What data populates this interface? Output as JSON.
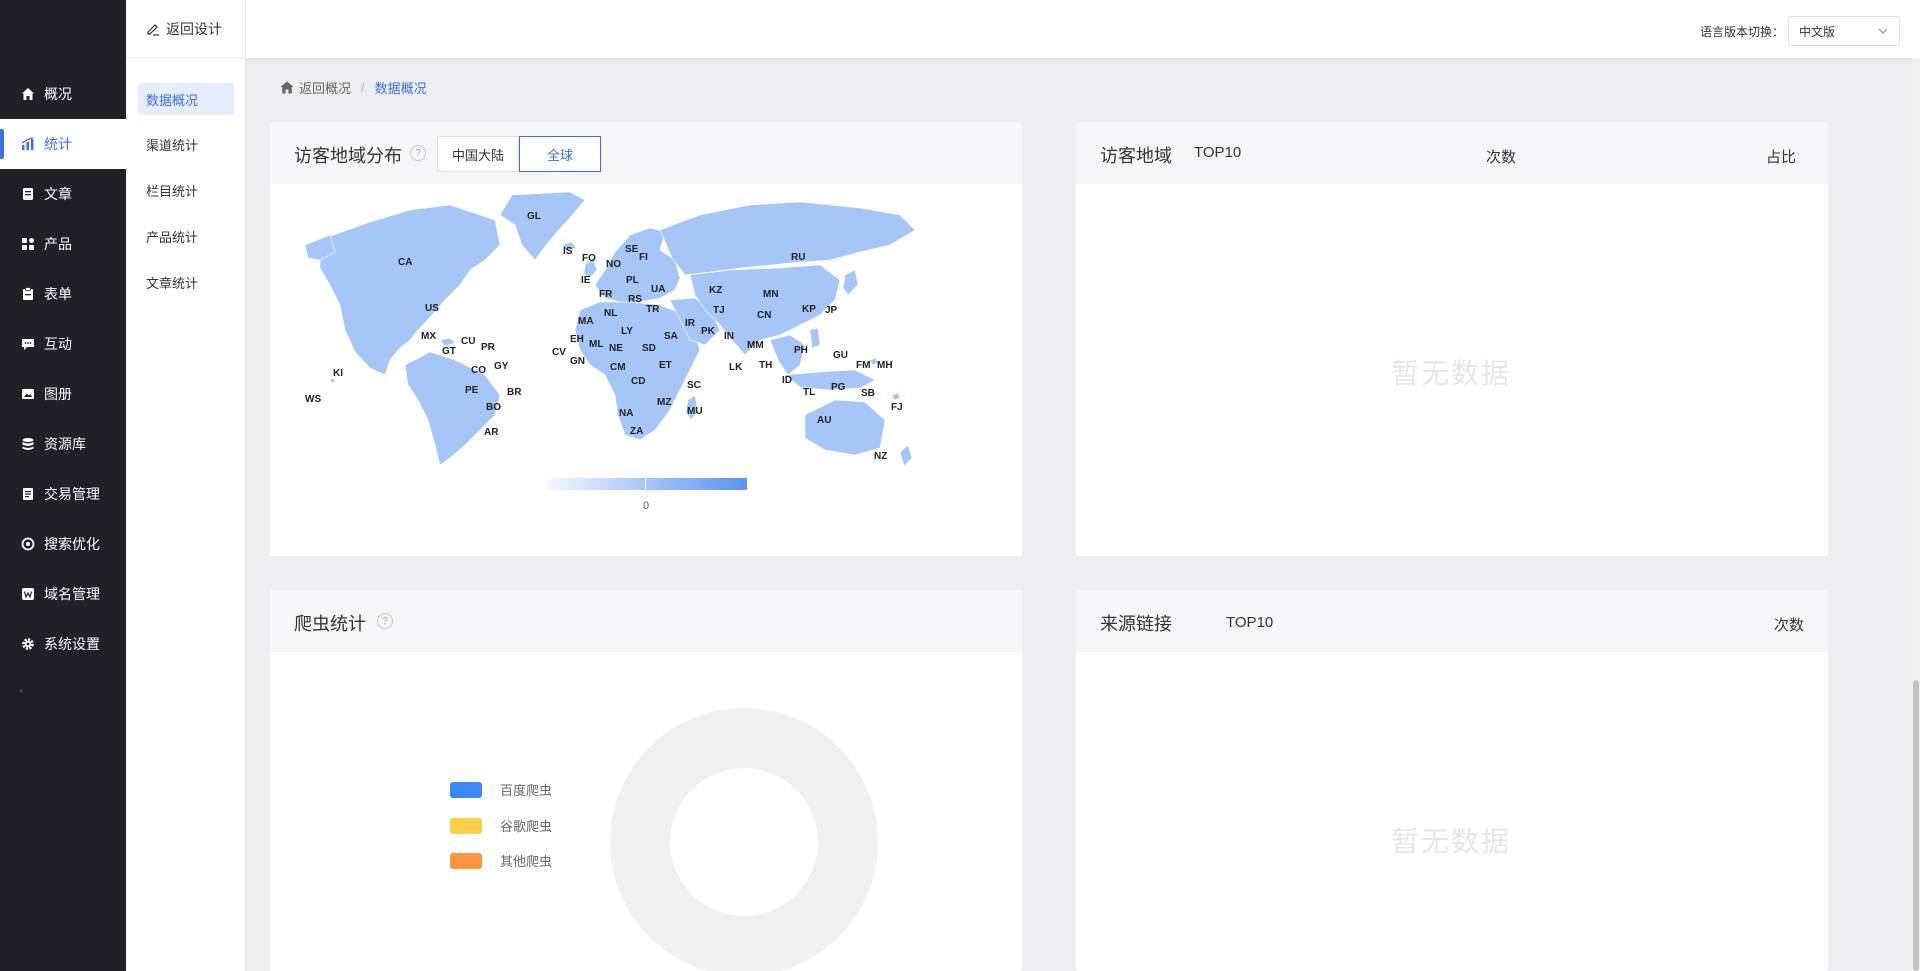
{
  "nav": {
    "items": [
      {
        "label": "概况",
        "icon": "home-icon"
      },
      {
        "label": "统计",
        "icon": "chart-icon"
      },
      {
        "label": "文章",
        "icon": "document-icon"
      },
      {
        "label": "产品",
        "icon": "grid-icon"
      },
      {
        "label": "表单",
        "icon": "clipboard-icon"
      },
      {
        "label": "互动",
        "icon": "chat-icon"
      },
      {
        "label": "图册",
        "icon": "image-icon"
      },
      {
        "label": "资源库",
        "icon": "database-icon"
      },
      {
        "label": "交易管理",
        "icon": "order-icon"
      },
      {
        "label": "搜索优化",
        "icon": "seo-icon"
      },
      {
        "label": "域名管理",
        "icon": "domain-icon"
      },
      {
        "label": "系统设置",
        "icon": "gear-icon"
      }
    ],
    "active_index": 1
  },
  "submenu": {
    "back_label": "返回设计",
    "items": [
      "数据概况",
      "渠道统计",
      "栏目统计",
      "产品统计",
      "文章统计"
    ],
    "active_index": 0
  },
  "topbar": {
    "lang_label": "语言版本切换：",
    "lang_value": "中文版"
  },
  "breadcrumb": {
    "home": "返回概况",
    "separator": "/",
    "current": "数据概况"
  },
  "visitor_map": {
    "title": "访客地域分布",
    "help": "?",
    "tabs": [
      "中国大陆",
      "全球"
    ],
    "selected_tab": 1,
    "legend_min": "0",
    "map_color": "#a6c6f8",
    "labels": [
      "GL",
      "CA",
      "IS",
      "FO",
      "NO",
      "SE",
      "FI",
      "RU",
      "IE",
      "PL",
      "UA",
      "FR",
      "RS",
      "KZ",
      "MN",
      "NL",
      "TR",
      "TJ",
      "CN",
      "KP",
      "JP",
      "US",
      "MA",
      "LY",
      "IR",
      "PK",
      "SA",
      "IN",
      "MX",
      "CU",
      "PR",
      "EH",
      "ML",
      "NE",
      "SD",
      "MM",
      "PH",
      "GU",
      "FM",
      "MH",
      "GT",
      "GY",
      "CV",
      "GN",
      "CM",
      "ET",
      "LK",
      "TH",
      "CO",
      "KI",
      "CD",
      "SC",
      "ID",
      "PG",
      "SB",
      "WS",
      "PE",
      "BR",
      "TL",
      "FJ",
      "MZ",
      "MU",
      "BO",
      "NA",
      "AU",
      "ZA",
      "AR",
      "NZ"
    ]
  },
  "visitor_region": {
    "title": "访客地域",
    "top": "TOP10",
    "col_count": "次数",
    "col_ratio": "占比",
    "empty": "暂无数据"
  },
  "crawler": {
    "title": "爬虫统计",
    "help": "?",
    "legend": [
      {
        "label": "百度爬虫",
        "color": "#3e86f3"
      },
      {
        "label": "谷歌爬虫",
        "color": "#fbcf47"
      },
      {
        "label": "其他爬虫",
        "color": "#fc9440"
      }
    ],
    "ring_color": "#f0f0f0"
  },
  "source_links": {
    "title": "来源链接",
    "top": "TOP10",
    "col_count": "次数",
    "empty": "暂无数据"
  }
}
